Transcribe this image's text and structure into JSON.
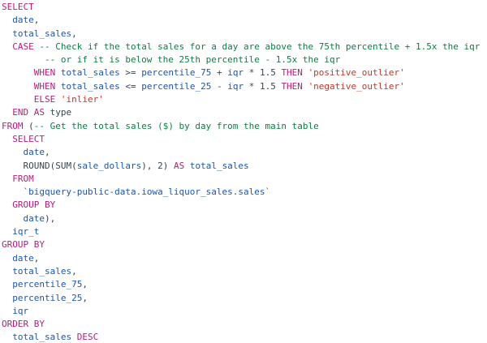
{
  "editor": {
    "colors": {
      "keyword": "#b71c7d",
      "identifier": "#1a56b3",
      "comment": "#0b8043",
      "string": "#c0392b",
      "plain": "#37474f"
    },
    "lines": [
      [
        {
          "t": "kw",
          "v": "SELECT"
        }
      ],
      [
        {
          "t": "pl",
          "v": "  "
        },
        {
          "t": "id",
          "v": "date"
        },
        {
          "t": "pl",
          "v": ","
        }
      ],
      [
        {
          "t": "pl",
          "v": "  "
        },
        {
          "t": "id",
          "v": "total_sales"
        },
        {
          "t": "pl",
          "v": ","
        }
      ],
      [
        {
          "t": "pl",
          "v": "  "
        },
        {
          "t": "kw",
          "v": "CASE"
        },
        {
          "t": "cm",
          "v": " -- Check if the total sales for a day are above the 75th percentile + 1.5x the iqr"
        }
      ],
      [
        {
          "t": "cm",
          "v": "        -- or if it is below the 25th percentile - 1.5x the iqr"
        }
      ],
      [
        {
          "t": "pl",
          "v": "      "
        },
        {
          "t": "kw",
          "v": "WHEN"
        },
        {
          "t": "pl",
          "v": " "
        },
        {
          "t": "id",
          "v": "total_sales"
        },
        {
          "t": "pl",
          "v": " >= "
        },
        {
          "t": "id",
          "v": "percentile_75"
        },
        {
          "t": "pl",
          "v": " + "
        },
        {
          "t": "id",
          "v": "iqr"
        },
        {
          "t": "pl",
          "v": " * 1.5 "
        },
        {
          "t": "kw",
          "v": "THEN"
        },
        {
          "t": "pl",
          "v": " "
        },
        {
          "t": "str",
          "v": "'positive_outlier'"
        }
      ],
      [
        {
          "t": "pl",
          "v": "      "
        },
        {
          "t": "kw",
          "v": "WHEN"
        },
        {
          "t": "pl",
          "v": " "
        },
        {
          "t": "id",
          "v": "total_sales"
        },
        {
          "t": "pl",
          "v": " <= "
        },
        {
          "t": "id",
          "v": "percentile_25"
        },
        {
          "t": "pl",
          "v": " - "
        },
        {
          "t": "id",
          "v": "iqr"
        },
        {
          "t": "pl",
          "v": " * 1.5 "
        },
        {
          "t": "kw",
          "v": "THEN"
        },
        {
          "t": "pl",
          "v": " "
        },
        {
          "t": "str",
          "v": "'negative_outlier'"
        }
      ],
      [
        {
          "t": "pl",
          "v": "      "
        },
        {
          "t": "kw",
          "v": "ELSE"
        },
        {
          "t": "pl",
          "v": " "
        },
        {
          "t": "str",
          "v": "'inlier'"
        }
      ],
      [
        {
          "t": "pl",
          "v": "  "
        },
        {
          "t": "kw",
          "v": "END"
        },
        {
          "t": "pl",
          "v": " "
        },
        {
          "t": "kw",
          "v": "AS"
        },
        {
          "t": "pl",
          "v": " type"
        }
      ],
      [
        {
          "t": "kw",
          "v": "FROM"
        },
        {
          "t": "pl",
          "v": " ("
        },
        {
          "t": "cm",
          "v": "-- Get the total sales ($) by day from the main table"
        }
      ],
      [
        {
          "t": "pl",
          "v": "  "
        },
        {
          "t": "kw",
          "v": "SELECT"
        }
      ],
      [
        {
          "t": "pl",
          "v": "    "
        },
        {
          "t": "id",
          "v": "date"
        },
        {
          "t": "pl",
          "v": ","
        }
      ],
      [
        {
          "t": "pl",
          "v": "    ROUND(SUM("
        },
        {
          "t": "id",
          "v": "sale_dollars"
        },
        {
          "t": "pl",
          "v": "), 2) "
        },
        {
          "t": "kw",
          "v": "AS"
        },
        {
          "t": "pl",
          "v": " "
        },
        {
          "t": "id",
          "v": "total_sales"
        }
      ],
      [
        {
          "t": "pl",
          "v": "  "
        },
        {
          "t": "kw",
          "v": "FROM"
        }
      ],
      [
        {
          "t": "pl",
          "v": "    "
        },
        {
          "t": "id",
          "v": "`bigquery-public-data.iowa_liquor_sales.sales`"
        }
      ],
      [
        {
          "t": "pl",
          "v": "  "
        },
        {
          "t": "kw",
          "v": "GROUP BY"
        }
      ],
      [
        {
          "t": "pl",
          "v": "    "
        },
        {
          "t": "id",
          "v": "date"
        },
        {
          "t": "pl",
          "v": "),"
        }
      ],
      [
        {
          "t": "pl",
          "v": "  "
        },
        {
          "t": "id",
          "v": "iqr_t"
        }
      ],
      [
        {
          "t": "kw",
          "v": "GROUP BY"
        }
      ],
      [
        {
          "t": "pl",
          "v": "  "
        },
        {
          "t": "id",
          "v": "date"
        },
        {
          "t": "pl",
          "v": ","
        }
      ],
      [
        {
          "t": "pl",
          "v": "  "
        },
        {
          "t": "id",
          "v": "total_sales"
        },
        {
          "t": "pl",
          "v": ","
        }
      ],
      [
        {
          "t": "pl",
          "v": "  "
        },
        {
          "t": "id",
          "v": "percentile_75"
        },
        {
          "t": "pl",
          "v": ","
        }
      ],
      [
        {
          "t": "pl",
          "v": "  "
        },
        {
          "t": "id",
          "v": "percentile_25"
        },
        {
          "t": "pl",
          "v": ","
        }
      ],
      [
        {
          "t": "pl",
          "v": "  "
        },
        {
          "t": "id",
          "v": "iqr"
        }
      ],
      [
        {
          "t": "kw",
          "v": "ORDER BY"
        }
      ],
      [
        {
          "t": "pl",
          "v": "  "
        },
        {
          "t": "id",
          "v": "total_sales"
        },
        {
          "t": "pl",
          "v": " "
        },
        {
          "t": "kw",
          "v": "DESC"
        }
      ]
    ]
  }
}
